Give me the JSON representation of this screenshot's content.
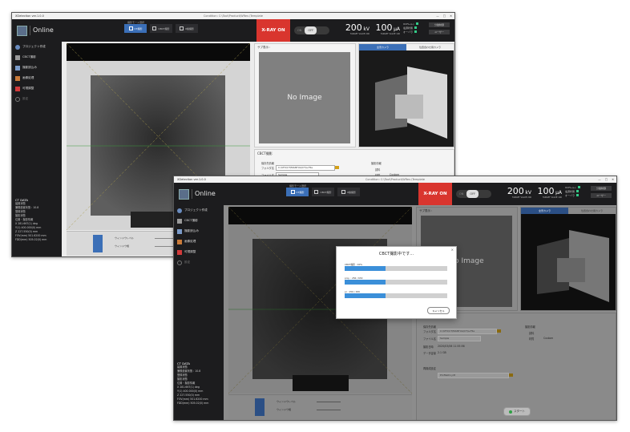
{
  "window": {
    "title": "XDetection ver.1.0.0",
    "subtitle": "Condition: C:\\Tool\\Product\\WRev.\\Template"
  },
  "header": {
    "mode": "Online",
    "modes_label": "撮影モード選択",
    "mode_buttons": [
      "CT撮影",
      "CBCT撮影",
      "X線撮影"
    ],
    "xray_on": "X-RAY ON",
    "toggle_on": "ON",
    "toggle_off": "OFF",
    "kv": {
      "value": "200",
      "unit": "kV",
      "caption": "TARGET VALUE 200"
    },
    "ua": {
      "value": "100",
      "unit": "μA",
      "caption": "TARGET VALUE 100"
    },
    "status": [
      "ICX%ｰﾙｰﾄ",
      "電源状態",
      "オーバラ"
    ],
    "side_buttons": [
      "分離制御",
      "ユーザー"
    ]
  },
  "sidebar": {
    "items": [
      {
        "label": "プロジェクト作成",
        "icon": "people-icon"
      },
      {
        "label": "CBCT撮影",
        "icon": "ct-icon"
      },
      {
        "label": "撮影読込み",
        "icon": "image-icon"
      },
      {
        "label": "画像処理",
        "icon": "process-icon"
      },
      {
        "label": "可視調整",
        "icon": "tools-icon"
      },
      {
        "label": "設定",
        "icon": "gear-icon"
      }
    ],
    "ct_title": "CT DATA",
    "ct_lines": [
      "装置状態",
      "  兼務設置状態 : 10.8",
      "  登録状態",
      "  撮影状態",
      "位置・撮影情報",
      "  X   281.667(1)  deg",
      "  Y(1) 400.000(0)  mm",
      "  Z    227.550(0)  mm",
      "  FOV(mm) 501.6200  mm",
      "  FDD(mm) 505.02(0) mm"
    ]
  },
  "main": {
    "subimage_caption": "サブ表示 :",
    "no_image": "No Image",
    "camera_tabs": [
      "全景カメラ",
      "位置合わせ用カメラ"
    ],
    "cbct_title": "CBCT撮影",
    "form_title": "保存先情報",
    "folder_label": "フォルダ名",
    "folder_value": "C:\\UFX\\CT\\MANTUA\\CT\\a-Flle",
    "file_label": "ファイル名",
    "file_value": "Sample",
    "date_label": "撮影日時",
    "date_value": "2020/03/06 11:55:56",
    "size_label": "データ容量",
    "size_value": "2.1 GB",
    "recon_label": "再構成設定",
    "recon_value": "Profile01.ydt",
    "info_title": "撮影情報",
    "info_rows": [
      "試料",
      "材質",
      "Custom"
    ],
    "ctrl_labels": [
      "ウィンドウレベル",
      "ウィンドウ幅"
    ],
    "start_button": "スタート"
  },
  "dialog": {
    "title": "CBCT撮影中です...",
    "close": "×",
    "rows": [
      {
        "label": "CBCT撮影 : 40%",
        "progress": 0.4
      },
      {
        "label": "proj. :   256 / 630",
        "progress": 0.4
      },
      {
        "label": "pr :   256 / 630",
        "progress": 0.4
      }
    ],
    "cancel": "キャンセル"
  }
}
